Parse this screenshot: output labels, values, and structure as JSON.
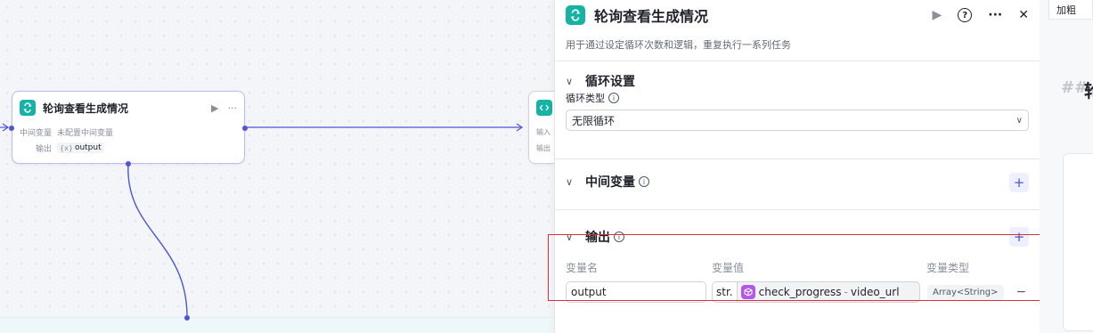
{
  "node_main": {
    "title": "轮询查看生成情况",
    "intermediate_label": "中间变量",
    "intermediate_value": "未配置中间变量",
    "output_label": "输出",
    "output_tag": "output"
  },
  "node_next": {
    "row1": "输入",
    "row2": "输出"
  },
  "panel": {
    "title": "轮询查看生成情况",
    "description": "用于通过设定循环次数和逻辑，重复执行一系列任务",
    "loop_section": {
      "title": "循环设置",
      "loop_type_label": "循环类型",
      "loop_type_value": "无限循环"
    },
    "var_section": {
      "title": "中间变量"
    },
    "output_section": {
      "title": "输出",
      "col_name": "变量名",
      "col_value": "变量值",
      "col_type": "变量类型",
      "row": {
        "name": "output",
        "value_type": "str.",
        "ref_node": "check_progress",
        "ref_sep": "-",
        "ref_field": "video_url",
        "var_type": "Array<String>"
      }
    }
  },
  "preview": {
    "tab_label": "加粗",
    "md_hash": "##",
    "md_char": "轮"
  },
  "colors": {
    "accent": "#4e55d6",
    "loop_icon": "#16b3a5",
    "ref_icon": "#b357e6",
    "highlight": "#d8313c"
  },
  "icons": [
    "loop-icon",
    "code-icon",
    "play-icon",
    "more-icon",
    "help-icon",
    "close-icon",
    "chevron-down-icon",
    "info-icon",
    "plus-icon",
    "minus-icon",
    "cube-icon"
  ]
}
